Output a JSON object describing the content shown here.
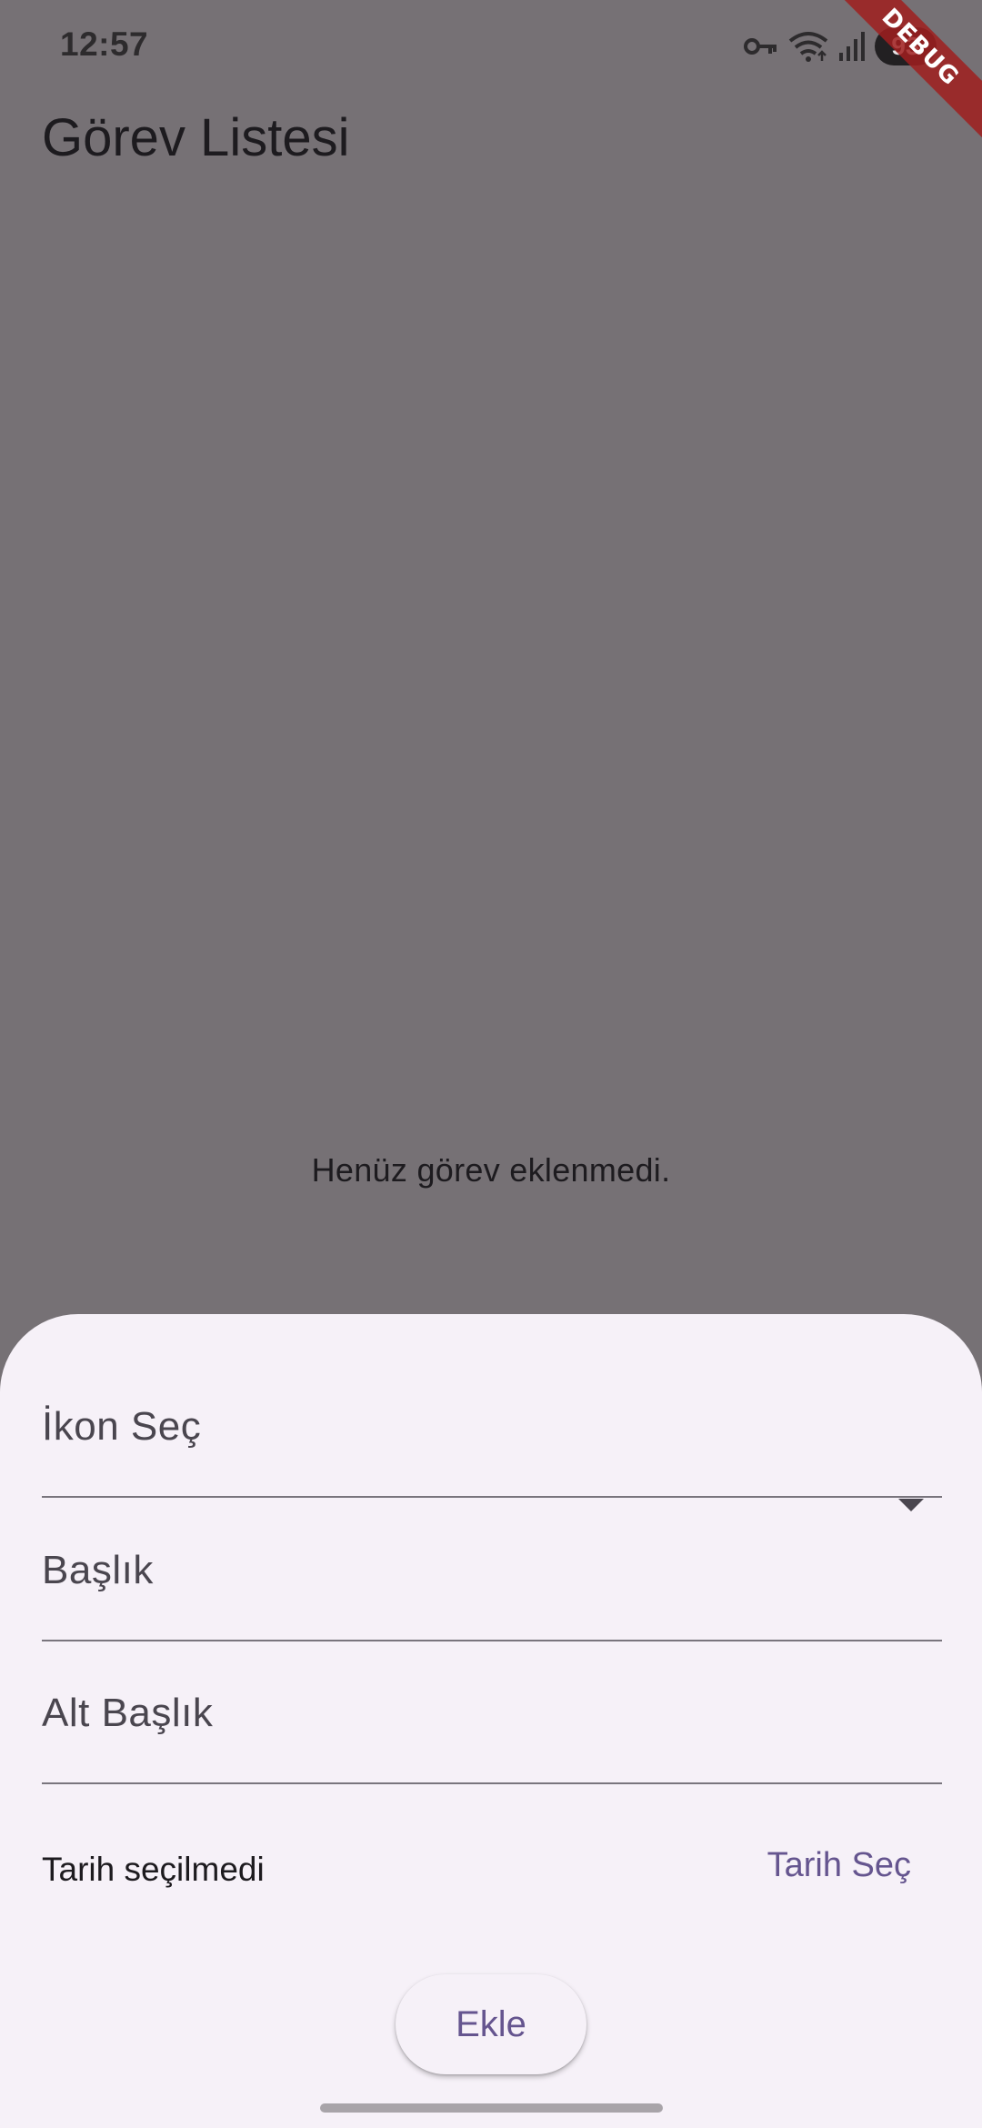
{
  "status_bar": {
    "time": "12:57",
    "battery": "93",
    "icons": [
      "vpn-key-icon",
      "wifi-icon",
      "signal-icon",
      "battery-icon"
    ]
  },
  "debug_banner": "DEBUG",
  "app_bar": {
    "title": "Görev Listesi"
  },
  "empty_state": {
    "message": "Henüz görev eklenmedi."
  },
  "sheet": {
    "icon_select": {
      "label": "İkon Seç",
      "icon": "arrow-drop-down-icon"
    },
    "title_field": {
      "label": "Başlık"
    },
    "subtitle_field": {
      "label": "Alt Başlık"
    },
    "date": {
      "status": "Tarih seçilmedi",
      "button_label": "Tarih Seç"
    },
    "add_button_label": "Ekle"
  },
  "colors": {
    "scrim_background": "#767175",
    "sheet_background": "#f6f1f8",
    "accent": "#65558f",
    "debug_banner": "#a01e1e"
  }
}
